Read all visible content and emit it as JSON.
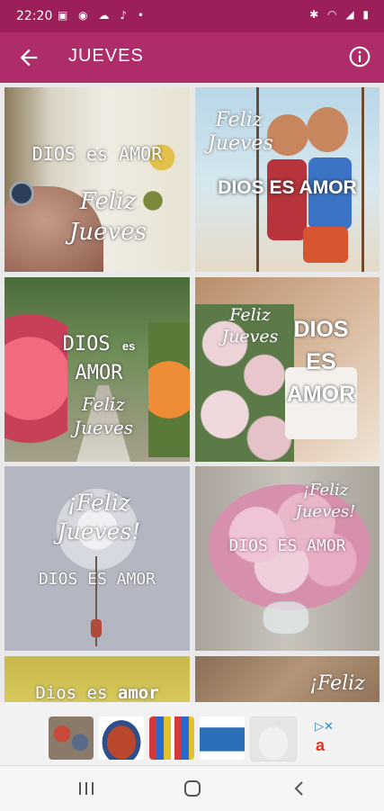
{
  "status_bar": {
    "time": "22:20",
    "left_icons": [
      "gallery-icon",
      "whatsapp-icon",
      "cloud-icon",
      "mic-icon",
      "dot-icon"
    ],
    "right_icons": [
      "bluetooth-icon",
      "wifi-icon",
      "signal-icon",
      "battery-icon"
    ]
  },
  "app_bar": {
    "title": "JUEVES",
    "back_icon": "arrow-left-icon",
    "info_icon": "info-circle-icon",
    "color": "#ae2c69"
  },
  "images": [
    {
      "name": "image-1",
      "lines": [
        "DIOS es AMOR",
        "Feliz",
        "Jueves"
      ]
    },
    {
      "name": "image-2",
      "lines": [
        "Feliz",
        "Jueves",
        "DIOS ES AMOR"
      ]
    },
    {
      "name": "image-3",
      "lines": [
        "DIOS",
        "es",
        "AMOR",
        "Feliz",
        "Jueves"
      ]
    },
    {
      "name": "image-4",
      "lines": [
        "Feliz",
        "Jueves",
        "DIOS",
        "ES",
        "AMOR"
      ]
    },
    {
      "name": "image-5",
      "lines": [
        "¡Feliz",
        "Jueves!",
        "DIOS ES AMOR"
      ]
    },
    {
      "name": "image-6",
      "lines": [
        "¡Feliz",
        "Jueves!",
        "DIOS ES AMOR"
      ]
    },
    {
      "name": "image-7",
      "lines": [
        "Dios es",
        "amor"
      ]
    },
    {
      "name": "image-8",
      "lines": [
        "¡Feliz"
      ]
    }
  ],
  "ad_banner": {
    "products": [
      "sneakers",
      "handbag",
      "phone-cases",
      "sofa-bed",
      "sneakers-white"
    ]
  },
  "nav_bar": {
    "buttons": [
      "recent-apps-icon",
      "home-icon",
      "back-icon"
    ]
  }
}
